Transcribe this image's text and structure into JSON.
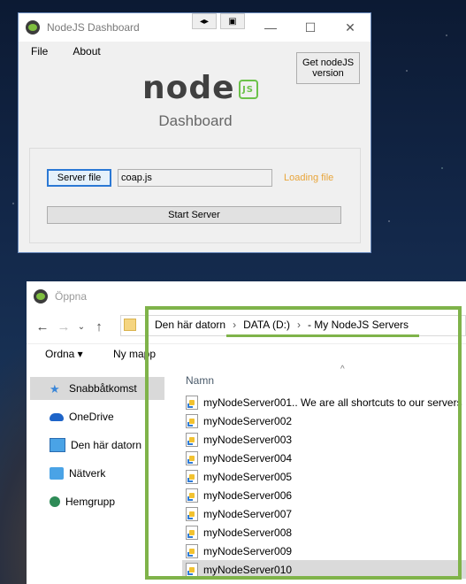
{
  "dashboard": {
    "title": "NodeJS Dashboard",
    "menu": [
      "File",
      "About"
    ],
    "version_button": "Get nodeJS\nversion",
    "logo_text": "node",
    "logo_badge": "JS",
    "heading": "Dashboard",
    "server_file_button": "Server file",
    "file_value": "coap.js",
    "status": "Loading file",
    "start_button": "Start Server",
    "extra_buttons": [
      "◂▸",
      "▣"
    ],
    "controls": [
      "—",
      "☐",
      "✕"
    ]
  },
  "open_dialog": {
    "title": "Öppna",
    "breadcrumb": [
      "Den här datorn",
      "DATA (D:)",
      "- My NodeJS Servers"
    ],
    "toolbar": {
      "organize": "Ordna ▾",
      "new_folder": "Ny mapp"
    },
    "sidebar": [
      {
        "label": "Snabbåtkomst",
        "icon": "star-icon"
      },
      {
        "label": "OneDrive",
        "icon": "cloud-icon"
      },
      {
        "label": "Den här datorn",
        "icon": "computer-icon"
      },
      {
        "label": "Nätverk",
        "icon": "network-icon"
      },
      {
        "label": "Hemgrupp",
        "icon": "homegroup-icon"
      }
    ],
    "column_header": "Namn",
    "files": [
      "myNodeServer001.. We are all shortcuts to our servers",
      "myNodeServer002",
      "myNodeServer003",
      "myNodeServer004",
      "myNodeServer005",
      "myNodeServer006",
      "myNodeServer007",
      "myNodeServer008",
      "myNodeServer009",
      "myNodeServer010"
    ],
    "selected_file_index": 9,
    "selected_sidebar_index": 0
  },
  "colors": {
    "highlight": "#7fb34a",
    "status": "#e8a53a",
    "node_green": "#6cc24a"
  }
}
